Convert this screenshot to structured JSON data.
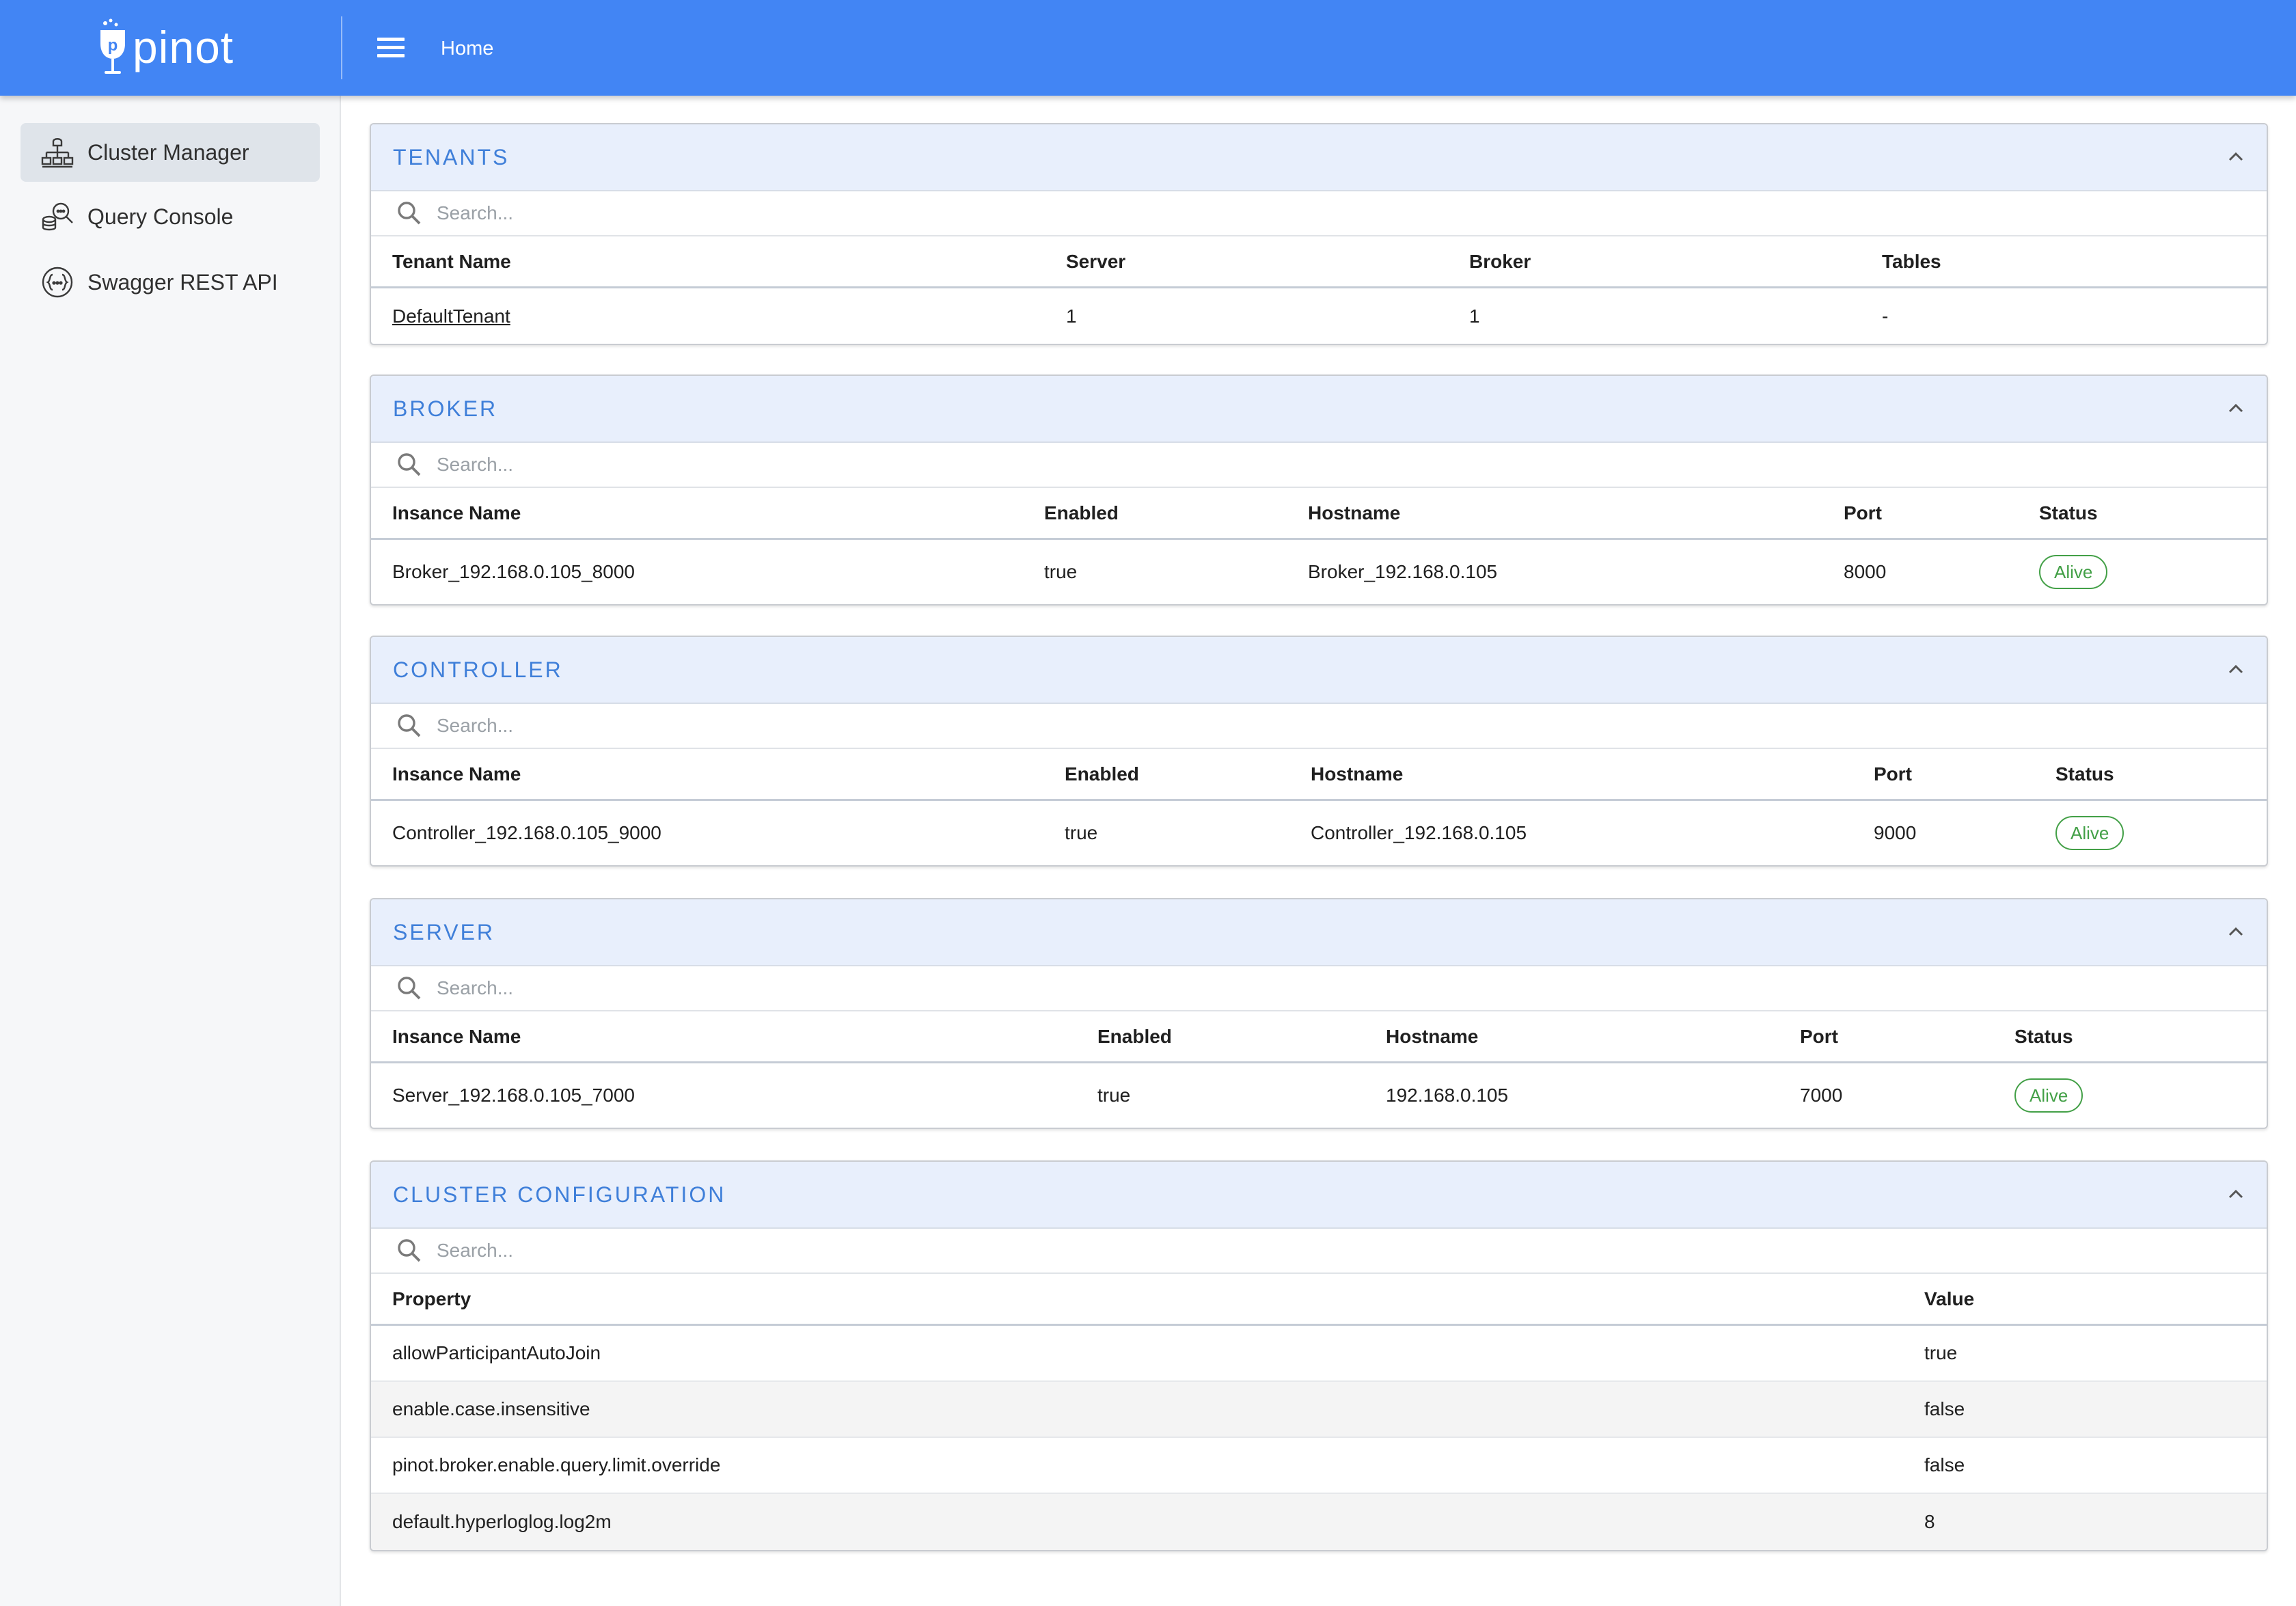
{
  "header": {
    "logo_text": "pinot",
    "breadcrumb": "Home"
  },
  "sidebar": {
    "items": [
      {
        "label": "Cluster Manager",
        "icon": "cluster-icon",
        "active": true
      },
      {
        "label": "Query Console",
        "icon": "query-console-icon",
        "active": false
      },
      {
        "label": "Swagger REST API",
        "icon": "swagger-api-icon",
        "active": false
      }
    ]
  },
  "search_placeholder": "Search...",
  "tenants": {
    "title": "TENANTS",
    "columns": [
      "Tenant Name",
      "Server",
      "Broker",
      "Tables"
    ],
    "rows": [
      {
        "name": "DefaultTenant",
        "server": "1",
        "broker": "1",
        "tables": "-"
      }
    ]
  },
  "broker": {
    "title": "BROKER",
    "columns": [
      "Insance Name",
      "Enabled",
      "Hostname",
      "Port",
      "Status"
    ],
    "rows": [
      {
        "name": "Broker_192.168.0.105_8000",
        "enabled": "true",
        "hostname": "Broker_192.168.0.105",
        "port": "8000",
        "status": "Alive"
      }
    ]
  },
  "controller": {
    "title": "CONTROLLER",
    "columns": [
      "Insance Name",
      "Enabled",
      "Hostname",
      "Port",
      "Status"
    ],
    "rows": [
      {
        "name": "Controller_192.168.0.105_9000",
        "enabled": "true",
        "hostname": "Controller_192.168.0.105",
        "port": "9000",
        "status": "Alive"
      }
    ]
  },
  "server": {
    "title": "SERVER",
    "columns": [
      "Insance Name",
      "Enabled",
      "Hostname",
      "Port",
      "Status"
    ],
    "rows": [
      {
        "name": "Server_192.168.0.105_7000",
        "enabled": "true",
        "hostname": "192.168.0.105",
        "port": "7000",
        "status": "Alive"
      }
    ]
  },
  "cluster_config": {
    "title": "CLUSTER CONFIGURATION",
    "columns": [
      "Property",
      "Value"
    ],
    "rows": [
      {
        "property": "allowParticipantAutoJoin",
        "value": "true"
      },
      {
        "property": "enable.case.insensitive",
        "value": "false"
      },
      {
        "property": "pinot.broker.enable.query.limit.override",
        "value": "false"
      },
      {
        "property": "default.hyperloglog.log2m",
        "value": "8"
      }
    ]
  },
  "colors": {
    "header": "#4285f4",
    "panel_title": "#3f7fd9",
    "status_alive": "#43a047"
  }
}
